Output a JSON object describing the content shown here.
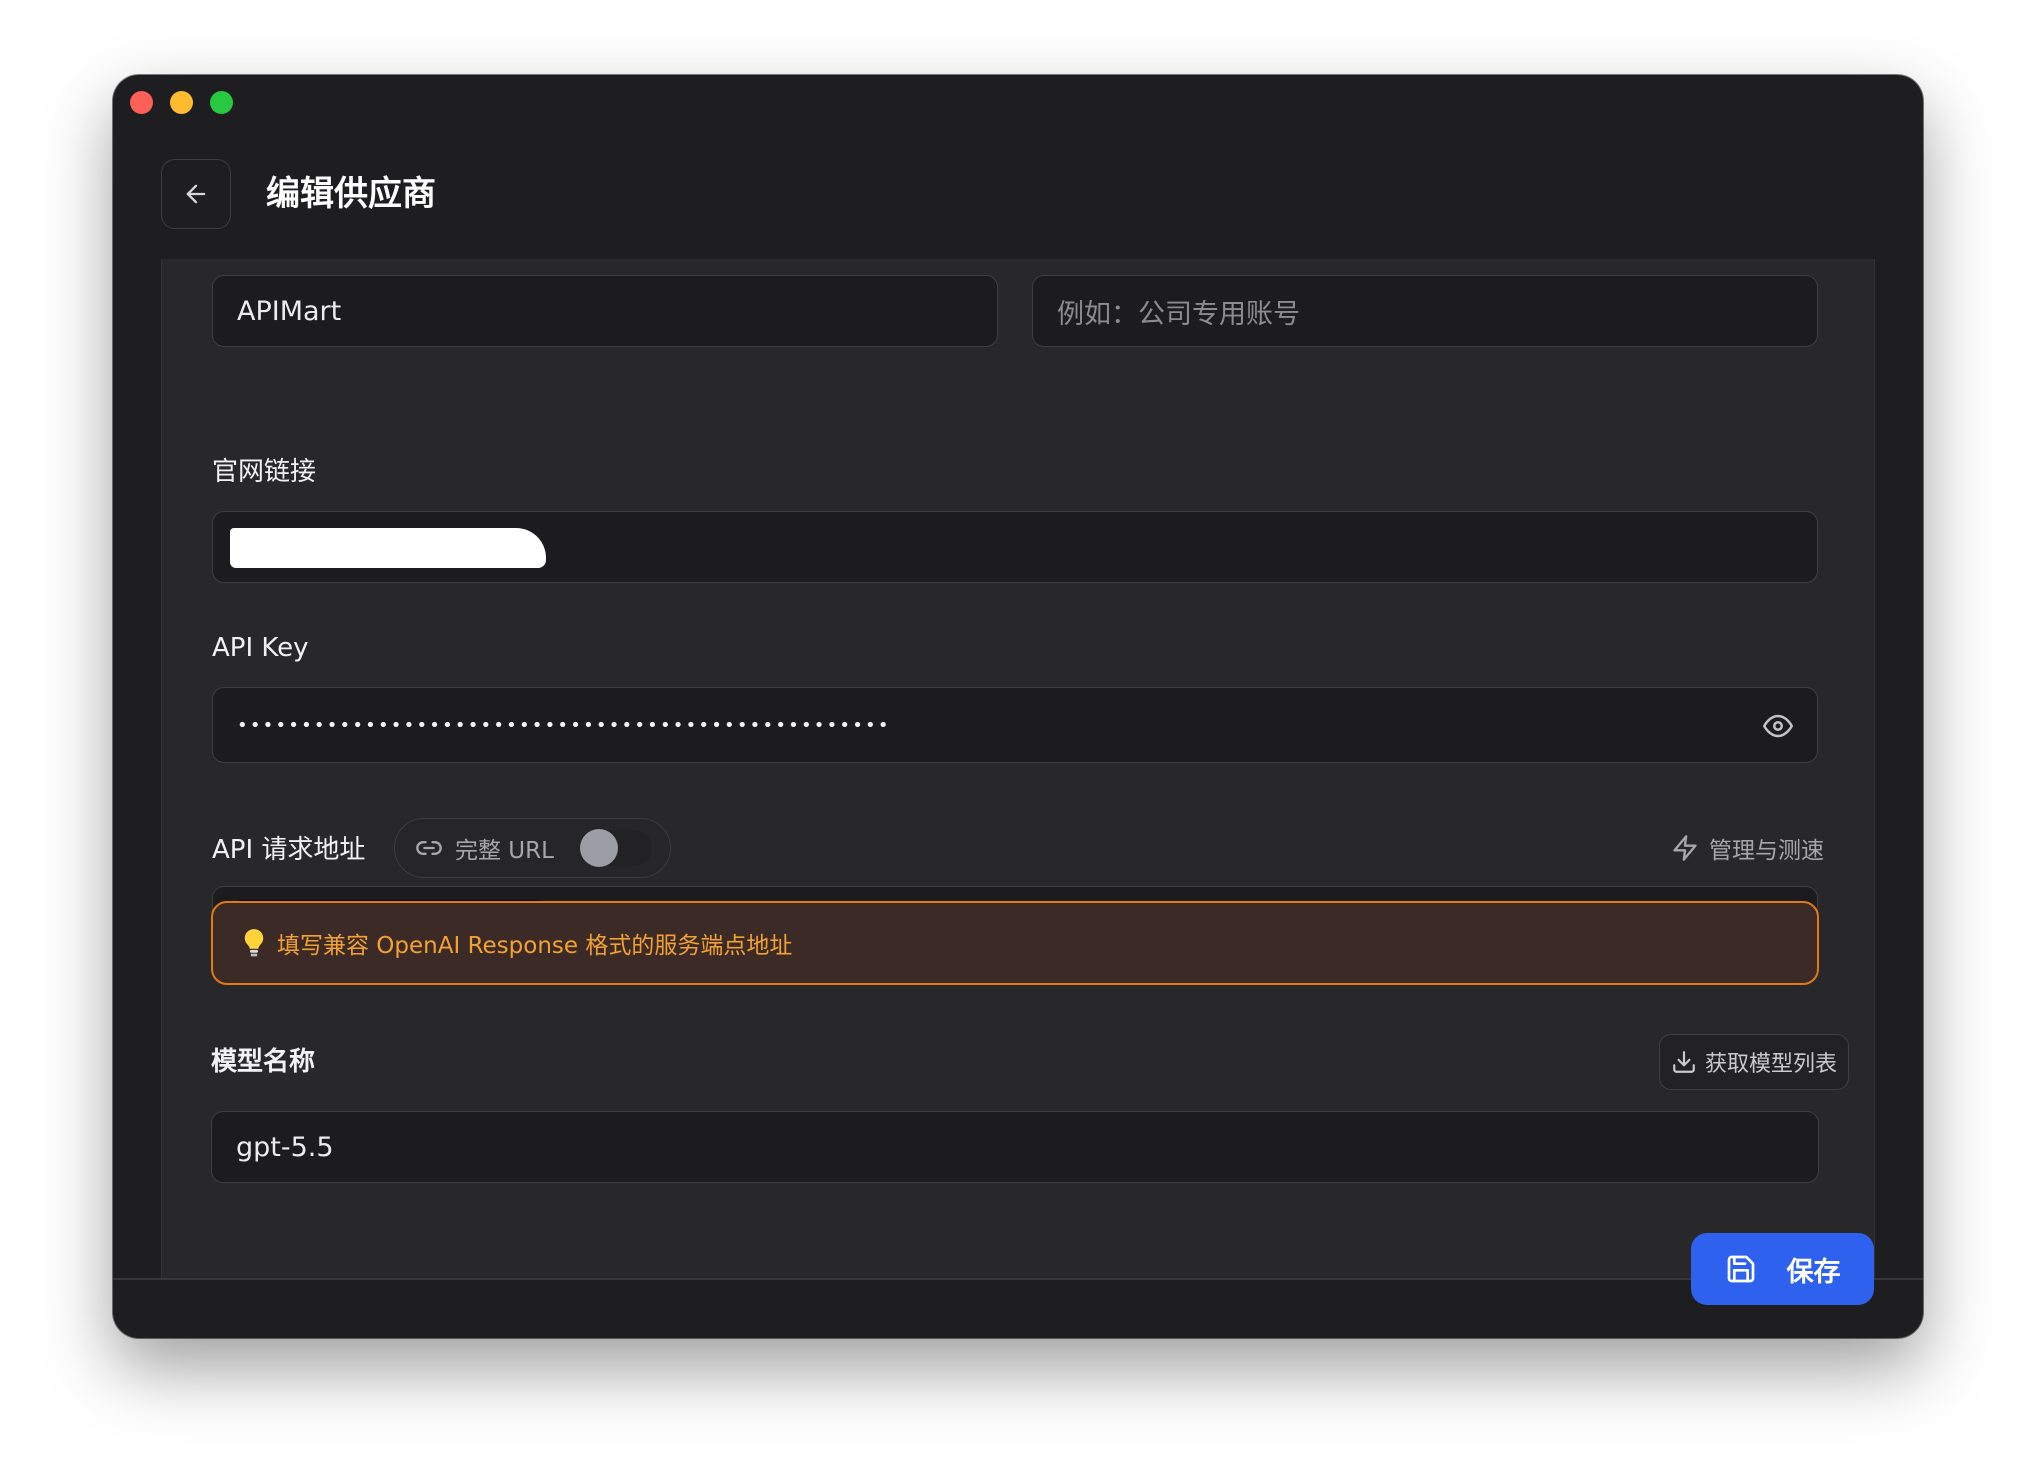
{
  "header": {
    "title": "编辑供应商"
  },
  "form": {
    "name_value": "APIMart",
    "remark_placeholder": "例如：公司专用账号",
    "website_label": "官网链接",
    "api_key_label": "API Key",
    "api_key_masked": "•••••••••••••••••••••••••••••••••••••••••••••••••••",
    "api_url_label": "API 请求地址",
    "full_url_label": "完整 URL",
    "full_url_enabled": false,
    "manage_label": "管理与测速",
    "hint_text": "填写兼容 OpenAI Response 格式的服务端点地址",
    "model_label": "模型名称",
    "fetch_models_label": "获取模型列表",
    "model_value": "gpt-5.5"
  },
  "footer": {
    "save_label": "保存"
  },
  "colors": {
    "accent": "#2e62ee",
    "warning_border": "#e07a14",
    "warning_text": "#f2a133"
  }
}
